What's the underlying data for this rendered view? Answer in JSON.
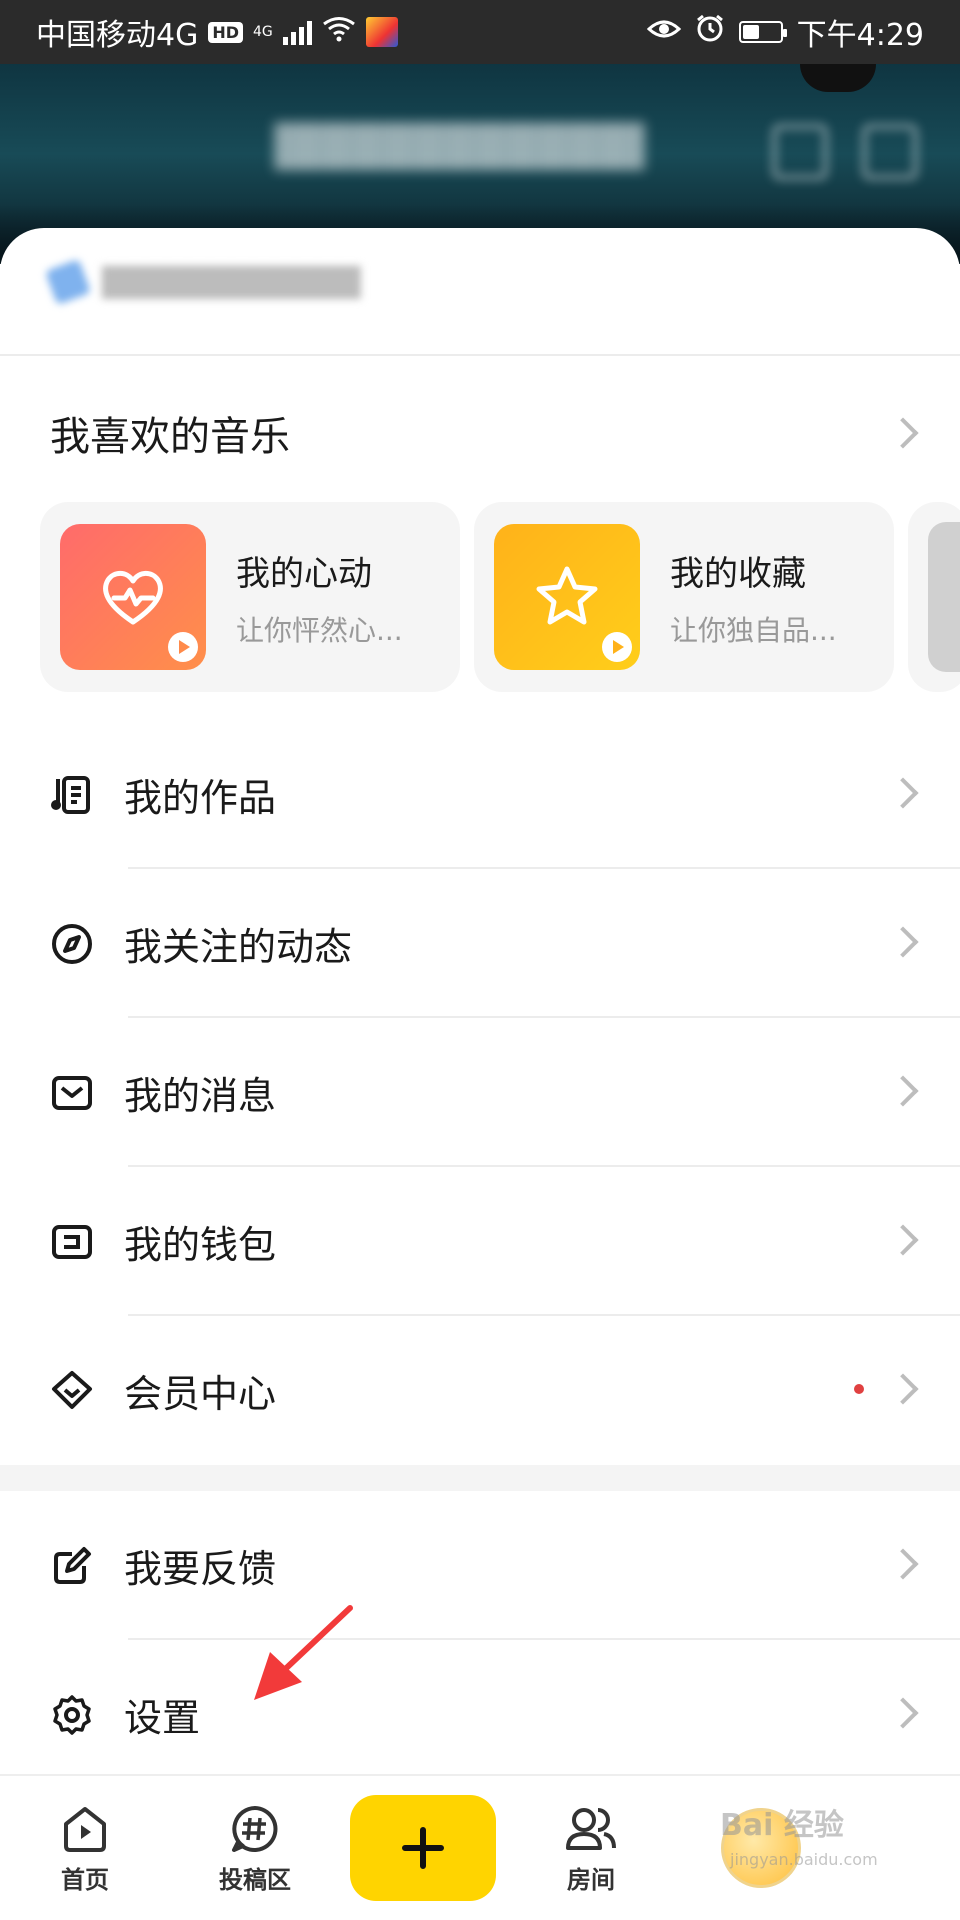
{
  "status_bar": {
    "carrier": "中国移动4G",
    "hd": "HD",
    "net": "4G",
    "time": "下午4:29",
    "battery_level": 0.45
  },
  "favorites": {
    "title": "我喜欢的音乐",
    "cards": [
      {
        "title": "我的心动",
        "subtitle": "让你怦然心..."
      },
      {
        "title": "我的收藏",
        "subtitle": "让你独自品..."
      }
    ]
  },
  "menu": {
    "items": [
      {
        "label": "我的作品",
        "icon": "music-list-icon"
      },
      {
        "label": "我关注的动态",
        "icon": "compass-icon"
      },
      {
        "label": "我的消息",
        "icon": "mail-icon"
      },
      {
        "label": "我的钱包",
        "icon": "wallet-icon"
      },
      {
        "label": "会员中心",
        "icon": "diamond-icon",
        "has_dot": true
      },
      {
        "label": "我要反馈",
        "icon": "feedback-edit-icon"
      },
      {
        "label": "设置",
        "icon": "gear-icon"
      }
    ]
  },
  "bottom_nav": {
    "items": [
      {
        "label": "首页",
        "icon": "home-play-icon"
      },
      {
        "label": "投稿区",
        "icon": "hashtag-bubble-icon"
      },
      {
        "label": "",
        "icon": "plus-icon"
      },
      {
        "label": "房间",
        "icon": "people-icon"
      },
      {
        "label": "",
        "icon": "avatar-icon"
      }
    ]
  },
  "watermark": {
    "text": "Bai 经验",
    "sub": "jingyan.baidu.com"
  },
  "colors": {
    "accent": "#ffd400",
    "dot": "#e04040",
    "arrow": "#f23a3a"
  }
}
